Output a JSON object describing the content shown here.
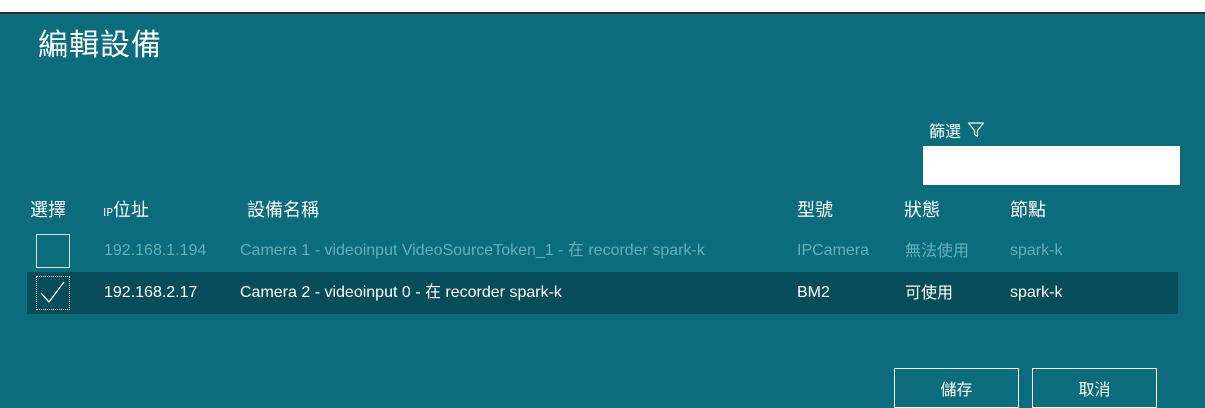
{
  "dialog": {
    "title": "編輯設備"
  },
  "filter": {
    "label": "篩選",
    "icon": "filter-icon",
    "value": ""
  },
  "table": {
    "headers": {
      "select": "選擇",
      "ip_prefix": "IP",
      "ip_suffix": "位址",
      "name": "設備名稱",
      "model": "型號",
      "status": "狀態",
      "node": "節點"
    },
    "rows": [
      {
        "checked": false,
        "ip": "192.168.1.194",
        "name": "Camera 1 - videoinput VideoSourceToken_1 - 在 recorder spark-k",
        "model": "IPCamera",
        "status": "無法使用",
        "node": "spark-k"
      },
      {
        "checked": true,
        "ip": "192.168.2.17",
        "name": "Camera 2 - videoinput 0 - 在 recorder spark-k",
        "model": "BM2",
        "status": "可使用",
        "node": "spark-k"
      }
    ]
  },
  "buttons": {
    "save": "儲存",
    "cancel": "取消"
  },
  "colors": {
    "background": "#0a6c7c",
    "selected_row": "#064d59",
    "disabled_text": "#63b0bb"
  }
}
